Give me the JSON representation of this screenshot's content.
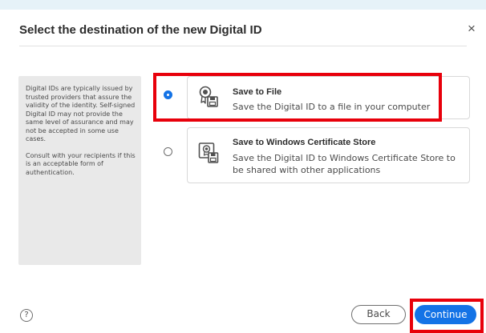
{
  "dialog": {
    "title": "Select the destination of the new Digital ID",
    "close_symbol": "×"
  },
  "info_panel": {
    "paragraph1": "Digital IDs are typically issued by trusted providers that assure the validity of the identity. Self-signed Digital ID may not provide the same level of assurance and may not be accepted in some use cases.",
    "paragraph2": "Consult with your recipients if this is an acceptable form of authentication."
  },
  "options": [
    {
      "title": "Save to File",
      "description": "Save the Digital ID to a file in your computer",
      "selected": true,
      "icon": "certificate-file-icon"
    },
    {
      "title": "Save to Windows Certificate Store",
      "description": "Save the Digital ID to Windows Certificate Store to be shared with other applications",
      "selected": false,
      "icon": "certificate-store-icon"
    }
  ],
  "footer": {
    "help_symbol": "?",
    "back_label": "Back",
    "continue_label": "Continue"
  },
  "colors": {
    "accent": "#1473e6",
    "highlight": "#e8000b",
    "backdrop": "#e6f2f8"
  }
}
